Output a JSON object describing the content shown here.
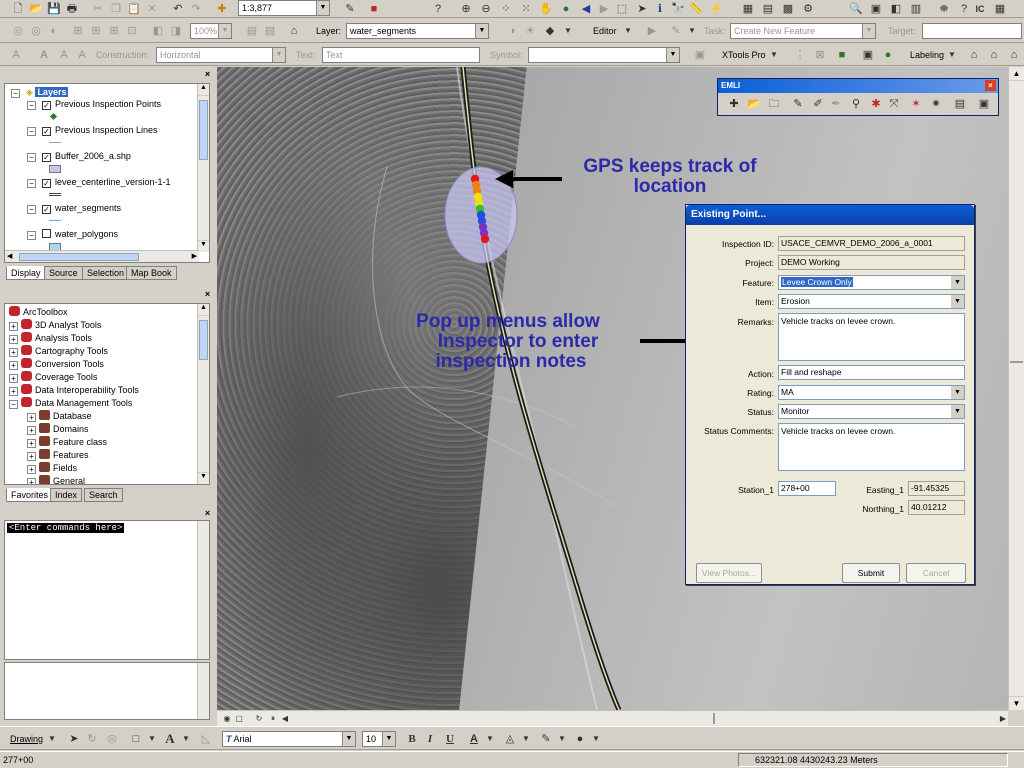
{
  "toolbar1": {
    "scale": "1:3,877"
  },
  "toolbar2": {
    "zoom": "100%",
    "layer_label": "Layer:",
    "layer_value": "water_segments",
    "editor_label": "Editor",
    "task_label": "Task:",
    "task_value": "Create New Feature",
    "target_label": "Target:"
  },
  "toolbar3": {
    "construction_label": "Construction:",
    "construction_value": "Horizontal",
    "text_label": "Text:",
    "text_value": "Text",
    "symbol_label": "Symbol:",
    "xtools_label": "XTools Pro",
    "labeling_label": "Labeling"
  },
  "toc": {
    "root": "Layers",
    "layers": [
      {
        "name": "Previous Inspection Points",
        "checked": true
      },
      {
        "name": "Previous Inspection Lines",
        "checked": true
      },
      {
        "name": "Buffer_2006_a.shp",
        "checked": true
      },
      {
        "name": "levee_centerline_version-1-1",
        "checked": true
      },
      {
        "name": "water_segments",
        "checked": true
      },
      {
        "name": "water_polygons",
        "checked": false
      }
    ],
    "tabs": [
      "Display",
      "Source",
      "Selection",
      "Map Book"
    ]
  },
  "toolbox": {
    "root": "ArcToolbox",
    "items": [
      {
        "name": "3D Analyst Tools",
        "level": 1
      },
      {
        "name": "Analysis Tools",
        "level": 1
      },
      {
        "name": "Cartography Tools",
        "level": 1
      },
      {
        "name": "Conversion Tools",
        "level": 1
      },
      {
        "name": "Coverage Tools",
        "level": 1
      },
      {
        "name": "Data Interoperability Tools",
        "level": 1
      },
      {
        "name": "Data Management Tools",
        "level": 1
      },
      {
        "name": "Database",
        "level": 2
      },
      {
        "name": "Domains",
        "level": 2
      },
      {
        "name": "Feature class",
        "level": 2
      },
      {
        "name": "Features",
        "level": 2
      },
      {
        "name": "Fields",
        "level": 2
      },
      {
        "name": "General",
        "level": 2
      }
    ],
    "tabs": [
      "Favorites",
      "Index",
      "Search"
    ]
  },
  "command": {
    "placeholder": "<Enter commands here>"
  },
  "emli": {
    "title": "EMLI"
  },
  "annotations": {
    "gps_line1": "GPS keeps track of",
    "gps_line2": "location",
    "popup_line1": "Pop up menus allow",
    "popup_line2": "Inspector to enter",
    "popup_line3": "inspection notes",
    "color": "#2c2aa8"
  },
  "dialog": {
    "title": "Existing Point...",
    "inspection_id_label": "Inspection ID:",
    "inspection_id": "USACE_CEMVR_DEMO_2006_a_0001",
    "project_label": "Project:",
    "project": "DEMO Working",
    "feature_label": "Feature:",
    "feature": "Levee Crown Only",
    "item_label": "Item:",
    "item": "Erosion",
    "remarks_label": "Remarks:",
    "remarks": "Vehicle tracks on levee crown.",
    "action_label": "Action:",
    "action": "Fill and reshape",
    "rating_label": "Rating:",
    "rating": "MA",
    "status_label": "Status:",
    "status": "Monitor",
    "status_comments_label": "Status Comments:",
    "status_comments": "Vehicle tracks on levee crown.",
    "station_label": "Station_1",
    "station": "278+00",
    "easting_label": "Easting_1",
    "easting": "-91.45325",
    "northing_label": "Northing_1",
    "northing": "40.01212",
    "view_photos": "View Photos...",
    "submit": "Submit",
    "cancel": "Cancel"
  },
  "drawing": {
    "drawing_label": "Drawing",
    "font": "Arial",
    "size": "10",
    "bold": "B",
    "italic": "I",
    "underline": "U"
  },
  "status": {
    "left": "277+00",
    "coords": "632321.08  4430243.23 Meters"
  },
  "gps_track_colors": [
    "#e01818",
    "#f08010",
    "#f0e010",
    "#30c030",
    "#2050e0",
    "#8030c0",
    "#e01818"
  ]
}
